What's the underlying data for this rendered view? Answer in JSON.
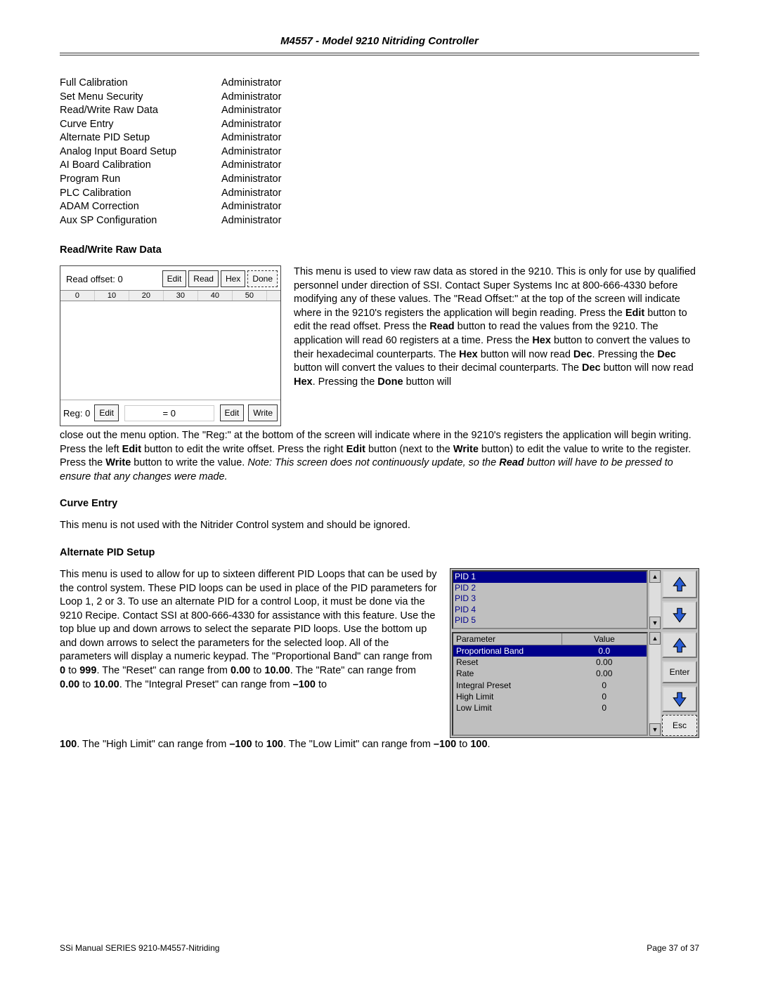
{
  "header": {
    "title": "M4557 - Model 9210 Nitriding Controller"
  },
  "permissions": {
    "items": [
      {
        "label": "Full Calibration",
        "role": "Administrator"
      },
      {
        "label": "Set Menu Security",
        "role": "Administrator"
      },
      {
        "label": "Read/Write Raw Data",
        "role": "Administrator"
      },
      {
        "label": "Curve Entry",
        "role": "Administrator"
      },
      {
        "label": "Alternate PID Setup",
        "role": "Administrator"
      },
      {
        "label": "Analog Input Board Setup",
        "role": "Administrator"
      },
      {
        "label": "AI Board Calibration",
        "role": "Administrator"
      },
      {
        "label": "Program Run",
        "role": "Administrator"
      },
      {
        "label": "PLC Calibration",
        "role": "Administrator"
      },
      {
        "label": "ADAM Correction",
        "role": "Administrator"
      },
      {
        "label": "Aux SP Configuration",
        "role": "Administrator"
      }
    ]
  },
  "sections": {
    "rw": {
      "title": "Read/Write Raw Data",
      "panel": {
        "read_offset_label": "Read offset: 0",
        "edit_btn": "Edit",
        "read_btn": "Read",
        "hex_btn": "Hex",
        "done_btn": "Done",
        "cols": [
          "0",
          "10",
          "20",
          "30",
          "40",
          "50",
          ""
        ],
        "reg_label": "Reg: 0",
        "bottom_edit1": "Edit",
        "eq_val": "= 0",
        "bottom_edit2": "Edit",
        "write_btn": "Write"
      },
      "body_parts": {
        "p1a": "This menu is used to view raw data as stored in the 9210.  This is only for use by qualified personnel under direction of SSI.  Contact Super Systems Inc at 800-666-4330 before modifying any of these values.  The \"Read Offset:\" at the top of the screen will indicate where in the 9210's registers the application will begin reading.  Press the ",
        "p1b": " button to edit the read offset.  Press the ",
        "p1c": " button to read the values from the 9210.  The application will read 60 registers at a time.  Press the ",
        "p1d": " button to convert the values to their hexadecimal counterparts.  The ",
        "p1e": " button will now read ",
        "p1f": ".  Pressing the ",
        "p1g": " button will convert the values to their decimal counterparts.  The ",
        "p1h": " button will now read ",
        "p1i": ".  Pressing the ",
        "p1j": " button will ",
        "p2a": "close out the menu option.  The \"Reg:\" at the bottom of the screen will indicate where in the 9210's registers the application will begin writing.  Press the left ",
        "p2b": " button to edit the write offset.   Press the right ",
        "p2c": " button (next to the ",
        "p2d": " button) to edit the value to write to the register.  Press the ",
        "p2e": " button to write the value.   ",
        "p2note_a": "Note:  This screen does not continuously update, so the ",
        "p2note_b": " button will have to be pressed to ensure that any changes were made.",
        "b_edit": "Edit",
        "b_read": "Read",
        "b_hex": "Hex",
        "b_dec": "Dec",
        "b_done": "Done",
        "b_write": "Write"
      }
    },
    "curve": {
      "title": "Curve Entry",
      "body": "This menu is not used with the Nitrider Control system and should be ignored."
    },
    "alt": {
      "title": "Alternate PID Setup",
      "panel": {
        "pids": [
          "PID 1",
          "PID 2",
          "PID 3",
          "PID 4",
          "PID 5"
        ],
        "param_header": "Parameter",
        "value_header": "Value",
        "rows": [
          {
            "p": "Proportional Band",
            "v": "0.0",
            "sel": true
          },
          {
            "p": "Reset",
            "v": "0.00"
          },
          {
            "p": "Rate",
            "v": "0.00"
          },
          {
            "p": "Integral Preset",
            "v": "0"
          },
          {
            "p": "High Limit",
            "v": "0"
          },
          {
            "p": "Low Limit",
            "v": "0"
          }
        ],
        "enter": "Enter",
        "esc": "Esc"
      },
      "body_parts": {
        "a": "This menu is used to allow for up to sixteen different PID Loops that can be used by the control system.  These PID loops can be used in place of the PID parameters for Loop 1, 2 or 3.  To use an alternate PID for a control Loop, it must be done via the 9210 Recipe. Contact SSI at 800-666-4330 for assistance with this feature.  Use the top blue up and down arrows to select the separate PID loops.  Use the bottom up and down arrows to select the parameters for the selected loop.  All of the parameters will display a numeric keypad.  The \"Proportional Band\" can range from ",
        "b": " to ",
        "c": ".  The \"Reset\" can range from ",
        "d": " to ",
        "e": ".  The \"Rate\" can range from ",
        "f": " to ",
        "g": ".  The \"Integral Preset\" can range from ",
        "h": " to ",
        "tail_a": ".  The \"High Limit\" can range from ",
        "tail_b": " to ",
        "tail_c": ".  The \"Low Limit\" can range from ",
        "tail_d": " to ",
        "tail_e": ".",
        "v0": "0",
        "v999": "999",
        "v000": "0.00",
        "v1000": "10.00",
        "vn100": "–100",
        "v100": "100"
      }
    }
  },
  "footer": {
    "left": "SSi Manual SERIES 9210-M4557-Nitriding",
    "right": "Page 37 of 37"
  }
}
